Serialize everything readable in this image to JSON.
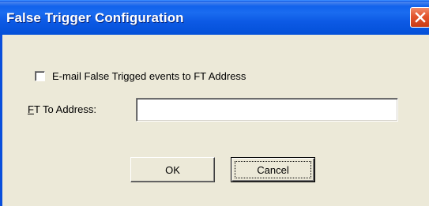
{
  "window": {
    "title": "False Trigger Configuration",
    "close_icon": "close-icon"
  },
  "form": {
    "email_checkbox": {
      "label": "E-mail False Trigged events to FT Address",
      "checked": false
    },
    "ft_to_address": {
      "label_mnemonic": "F",
      "label_rest": "T To Address:",
      "value": "",
      "placeholder": ""
    }
  },
  "buttons": {
    "ok_label": "OK",
    "cancel_label": "Cancel"
  },
  "colors": {
    "titlebar": "#0a59e8",
    "close_button": "#e2552e",
    "dialog_background": "#ece9d8"
  }
}
